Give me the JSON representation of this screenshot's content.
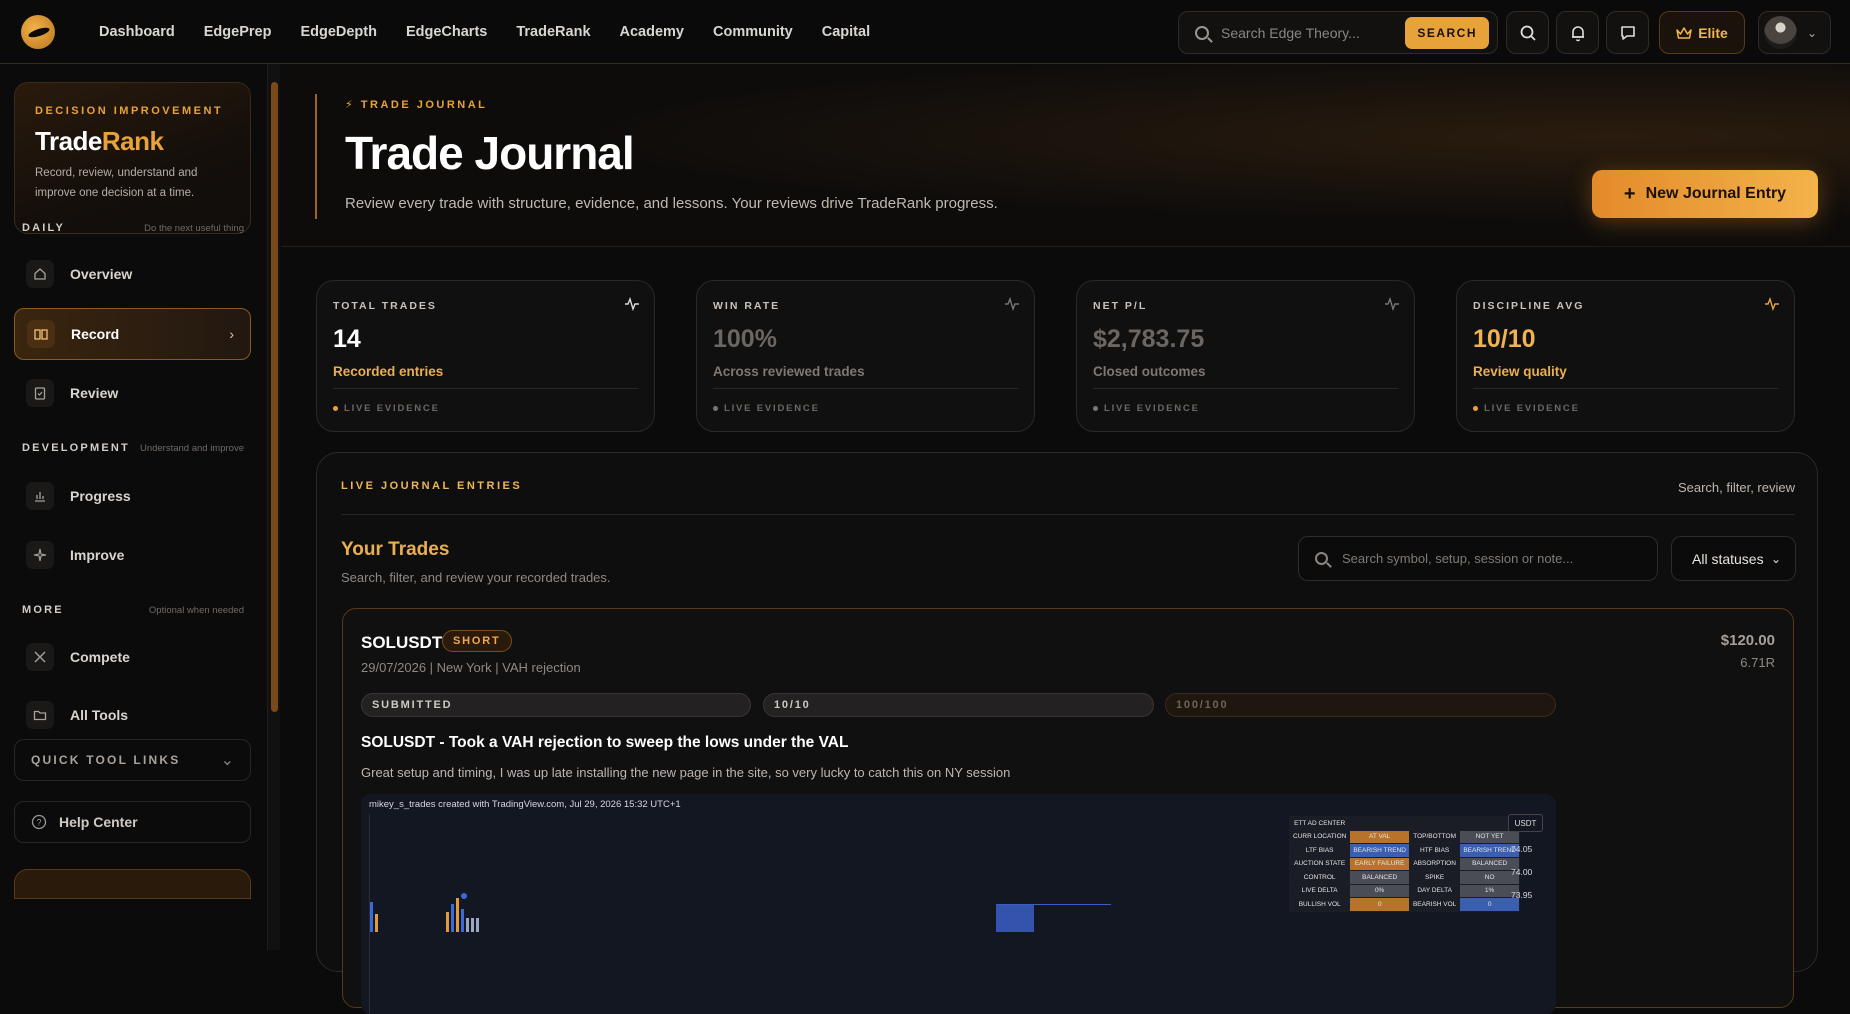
{
  "nav": {
    "links": [
      "Dashboard",
      "EdgePrep",
      "EdgeDepth",
      "EdgeCharts",
      "TradeRank",
      "Academy",
      "Community",
      "Capital"
    ],
    "search_placeholder": "Search Edge Theory...",
    "search_button": "SEARCH",
    "elite_label": "Elite"
  },
  "sidebar": {
    "brand_kicker": "DECISION IMPROVEMENT",
    "brand_title_a": "Trade",
    "brand_title_b": "Rank",
    "brand_desc": "Record, review, understand and improve one decision at a time.",
    "sections": [
      {
        "title": "DAILY",
        "sub": "Do the next useful thing"
      },
      {
        "title": "DEVELOPMENT",
        "sub": "Understand and improve"
      },
      {
        "title": "MORE",
        "sub": "Optional when needed"
      }
    ],
    "items": [
      {
        "label": "Overview",
        "icon": "home-icon"
      },
      {
        "label": "Record",
        "icon": "book-icon",
        "active": true
      },
      {
        "label": "Review",
        "icon": "clipboard-icon"
      },
      {
        "label": "Progress",
        "icon": "bar-chart-icon"
      },
      {
        "label": "Improve",
        "icon": "sparkles-icon"
      },
      {
        "label": "Compete",
        "icon": "swords-icon"
      },
      {
        "label": "All Tools",
        "icon": "folder-icon"
      }
    ],
    "quick_links": "QUICK TOOL LINKS",
    "help_center": "Help Center"
  },
  "hero": {
    "kicker": "TRADE JOURNAL",
    "title": "Trade Journal",
    "subtitle": "Review every trade with structure, evidence, and lessons. Your reviews drive TradeRank progress.",
    "new_entry": "New Journal Entry"
  },
  "stats": [
    {
      "header": "TOTAL TRADES",
      "value": "14",
      "label": "Recorded entries",
      "evidence": "LIVE EVIDENCE",
      "value_color": "#ffffff",
      "label_color": "#eab04f"
    },
    {
      "header": "WIN RATE",
      "value": "100%",
      "label": "Across reviewed trades",
      "evidence": "LIVE EVIDENCE",
      "value_color": "#6b6661",
      "label_color": "#7d7873"
    },
    {
      "header": "NET P/L",
      "value": "$2,783.75",
      "label": "Closed outcomes",
      "evidence": "LIVE EVIDENCE",
      "value_color": "#6b6661",
      "label_color": "#7d7873"
    },
    {
      "header": "DISCIPLINE AVG",
      "value": "10/10",
      "label": "Review quality",
      "evidence": "LIVE EVIDENCE",
      "value_color": "#f0b34f",
      "label_color": "#eab04f"
    }
  ],
  "entries": {
    "kicker": "LIVE JOURNAL ENTRIES",
    "right_text": "Search, filter, review",
    "your_trades": "Your Trades",
    "your_trades_sub": "Search, filter, and review your recorded trades.",
    "search_placeholder": "Search symbol, setup, session or note...",
    "status_filter": "All statuses"
  },
  "trade": {
    "symbol": "SOLUSDT",
    "side": "SHORT",
    "meta": "29/07/2026 | New York | VAH rejection",
    "amount": "$120.00",
    "r_multiple": "6.71R",
    "status": "SUBMITTED",
    "discipline": "10/10",
    "score": "100/100",
    "title": "SOLUSDT - Took a VAH rejection to sweep the lows under the VAL",
    "note": "Great setup and timing, I was up late installing the new page in the site, so very lucky to catch this on NY session",
    "chart_caption": "mikey_s_trades created with TradingView.com, Jul 29, 2026 15:32 UTC+1",
    "chart_currency": "USDT",
    "prices": [
      "74.05",
      "74.00",
      "73.95"
    ],
    "table": [
      [
        "ETT AD CENTER",
        "",
        "",
        ""
      ],
      [
        "CURR LOCATION",
        "AT VAL",
        "TOP/BOTTOM",
        "NOT YET"
      ],
      [
        "LTF BIAS",
        "BEARISH TREND",
        "HTF BIAS",
        "BEARISH TREND"
      ],
      [
        "AUCTION STATE",
        "EARLY FAILURE",
        "ABSORPTION",
        "BALANCED"
      ],
      [
        "CONTROL",
        "BALANCED",
        "SPIKE",
        "NO"
      ],
      [
        "LIVE DELTA",
        "0%",
        "DAY DELTA",
        "1%"
      ],
      [
        "BULLISH VOL",
        "0",
        "BEARISH VOL",
        "0"
      ]
    ]
  }
}
